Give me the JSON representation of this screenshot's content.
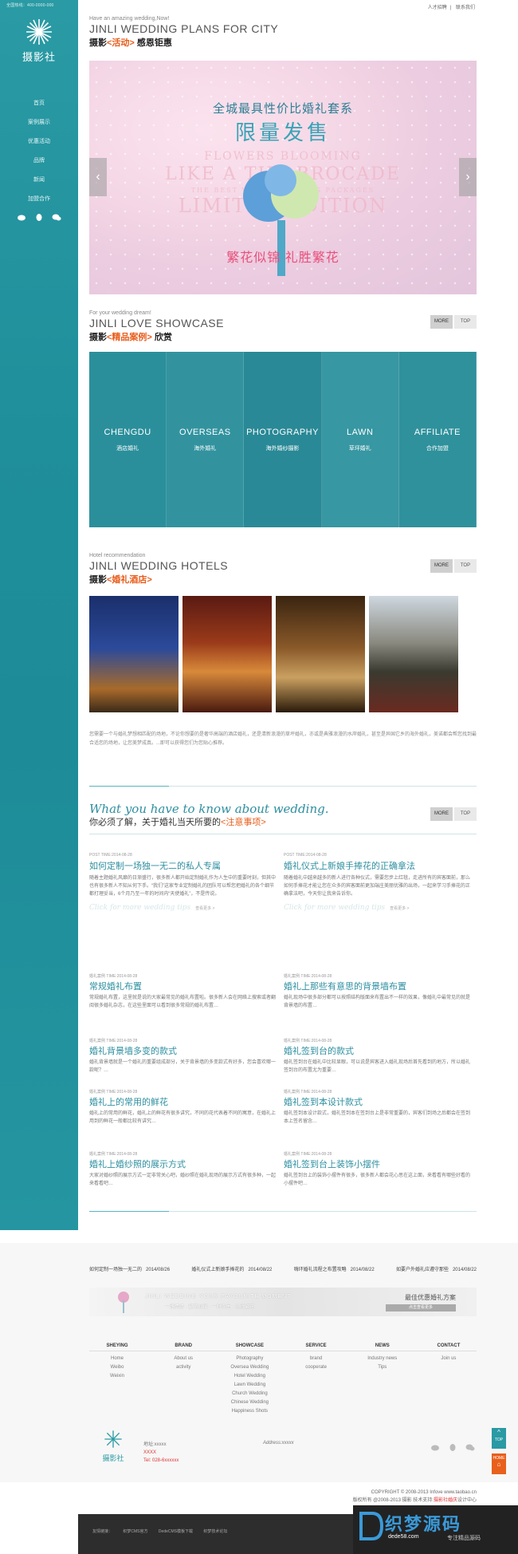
{
  "sidebar": {
    "phone_line": "全国热线：400-0000-000",
    "logo_text": "摄影社",
    "nav": [
      "首页",
      "案例展示",
      "优惠活动",
      "品牌",
      "新闻",
      "加盟合作"
    ]
  },
  "toplinks": {
    "jobs": "人才招聘",
    "contact": "联系我们"
  },
  "plans": {
    "tag": "Have an amazing wedding,Now!",
    "en_title": "JINLI WEDDING PLANS FOR CITY",
    "cn_prefix": "摄影",
    "cn_hl": "<活动>",
    "cn_suffix": "感恩钜惠"
  },
  "banner": {
    "line1": "全城最具性价比婚礼套系",
    "line2": "限量发售",
    "faint1": "FLOWERS BLOOMING",
    "faint2": "LIKE A THE BROCADE",
    "faint3": "THE BEST VALUE WEDDING PACKAGES",
    "faint4": "LIMITED EDITION",
    "bottom": "繁花似锦 礼胜繁花",
    "prev": "‹",
    "next": "›"
  },
  "showcase": {
    "tag": "For your wedding dream!",
    "en_title": "JINLI LOVE SHOWCASE",
    "cn_prefix": "摄影",
    "cn_hl": "<精品案例>",
    "cn_suffix": "欣赏",
    "more": "MORE",
    "top": "TOP",
    "items": [
      {
        "en": "CHENGDU",
        "cn": "酒店婚礼",
        "color": "#2b8f9b"
      },
      {
        "en": "OVERSEAS",
        "cn": "海外婚礼",
        "color": "#32939f"
      },
      {
        "en": "PHOTOGRAPHY",
        "cn": "海外婚纱摄影",
        "color": "#2a8996"
      },
      {
        "en": "LAWN",
        "cn": "草坪婚礼",
        "color": "#3797a2"
      },
      {
        "en": "AFFILIATE",
        "cn": "合作加盟",
        "color": "#2f919c"
      }
    ]
  },
  "hotels": {
    "tag": "Hotel recommendation",
    "en_title": "JINLI WEDDING HOTELS",
    "cn_prefix": "摄影",
    "cn_hl": "<婚礼酒店>",
    "more": "MORE",
    "top": "TOP",
    "desc": "您需要一个与婚礼梦想相匹配的场地，不论你想要的是奢华高端的酒店婚礼，还是清新浪漫的草坪婚礼，亦或是典雅浪漫的水岸婚礼，甚至是异国它乡的海外婚礼，美诺都会帮您找到最合适您的场地，让您美梦成真。...即可以获得您们为您贴心推荐。"
  },
  "knowledge": {
    "script_title": "What you have to know about wedding.",
    "sub_prefix": "你必须了解，关于婚礼当天所要的",
    "sub_hl": "<注意事项>",
    "more": "MORE",
    "top": "TOP",
    "featured": [
      {
        "meta": "POST TIME:2014-08-28",
        "title": "如何定制一场独一无二的私人专属",
        "desc": "随着主题婚礼风靡的日渐盛行，很多新人都开始定制婚礼作为人生中的重要时刻，但其中也有很多新人不知从何下手。“我们”这家专业定制婚礼的团队可以帮您把婚礼的各个细节都打理妥当，6个月乃至一年的时间内“天使婚礼”，不是传说。",
        "cursive": "Click for more wedding tips",
        "more": "查看更多 >"
      },
      {
        "meta": "POST TIME:2014-08-28",
        "title": "婚礼仪式上新娘手捧花的正确拿法",
        "desc": "随着婚礼中越来越多的新人进行各种仪式，需要您步上红毯，走进所有的宾客面前，那么如何手捧花才能让您在众多的宾客面前更加端庄美丽优雅的出场，一起来学习手捧花的正确拿法吧，今天你让我来告诉你。",
        "cursive": "Click for more wedding tips",
        "more": "查看更多 >"
      }
    ],
    "list": [
      {
        "meta": "婚礼案例  TIME:2014-08-28",
        "title": "常规婚礼布置",
        "desc": "常规婚礼布置，这里就是说的大家最常见的婚礼布置啦。很多新人会在网络上搜索或者翻阅很多婚礼杂志，在这些里面可以看到很多常规的婚礼布置…"
      },
      {
        "meta": "婚礼案例  TIME:2014-08-28",
        "title": "婚礼上那些有意思的背景墙布置",
        "desc": "婚礼现场中很多部分都可以按照结构版面来布置出不一样的效果，像婚礼中最常见的就是背景墙的布置…"
      },
      {
        "meta": "婚礼案例  TIME:2014-08-28",
        "title": "婚礼背景墙多变的款式",
        "desc": "婚礼背景墙就是一个婚礼的重要组成部分，关于背景墙的多变款式有好多，您会喜欢哪一款呢？…"
      },
      {
        "meta": "婚礼案例  TIME:2014-08-28",
        "title": "婚礼签到台的款式",
        "desc": "婚礼签到台在婚礼中比较显眼，可以说是宾客进入婚礼现场后首先看到的地方，所以婚礼签到台的布置尤为重要…"
      },
      {
        "meta": "婚礼案例  TIME:2014-08-28",
        "title": "婚礼上的常用的鲜花",
        "desc": "婚礼上的常用的鲜花，婚礼上的鲜花有很多讲究，不同的花代表着不同的寓意，在婚礼上用到的鲜花一般都比较有讲究…"
      },
      {
        "meta": "婚礼案例  TIME:2014-08-28",
        "title": "婚礼签到本设计款式",
        "desc": "婚礼签到本设计款式，婚礼签到本在签到台上是非常重要的，宾客们到场之后都会在签到本上签名留念…"
      },
      {
        "meta": "婚礼案例  TIME:2014-08-28",
        "title": "婚礼上婚纱照的展示方式",
        "desc": "大家对婚纱照的展示方式一定非常关心吧，婚纱照在婚礼现场的展示方式有很多种，一起来看看吧…"
      },
      {
        "meta": "婚礼案例  TIME:2014-08-28",
        "title": "婚礼签到台上装饰小摆件",
        "desc": "婚礼签到台上的装饰小摆件有很多，很多新人都会花心思在这上面，来看看有哪些好看的小摆件吧…"
      }
    ]
  },
  "footer": {
    "news": [
      {
        "title": "如何定制一场独一无二的",
        "date": "2014/08/26"
      },
      {
        "title": "婚礼仪式上新娘手捧花的",
        "date": "2014/08/22"
      },
      {
        "title": "嗨环婚礼流程之布置攻略",
        "date": "2014/08/22"
      },
      {
        "title": "如要户外婚礼应遵守那些",
        "date": "2014/08/22"
      }
    ],
    "ad_line1": "JINLI WEDDING  YOUR FAVOURITE MOMENT",
    "ad_line2": "一路情缘 · 繁花似锦 · 一时许生 · 礼胜繁花",
    "ad_right1": "最佳优惠婚礼方案",
    "ad_right2": "点击查看更多",
    "sitemap_heads": [
      "SHEYING",
      "BRAND",
      "SHOWCASE",
      "SERVICE",
      "NEWS",
      "CONTACT"
    ],
    "sitemap_cols": [
      [
        "Home",
        "Weibo",
        "Weixin"
      ],
      [
        "About us",
        "activity"
      ],
      [
        "Photography",
        "Oversea Wedding",
        "Hotel Wedding",
        "Lawn Wedding",
        "Church Wedding",
        "Chinese Wedding",
        "Happiness Shots"
      ],
      [
        "brand",
        "cooperate"
      ],
      [
        "Industry news",
        "Tips"
      ],
      [
        "Join us"
      ]
    ],
    "logo2_text": "摄影社",
    "addr1": "地址:xxxxx",
    "addr_red": "XXXX",
    "tel": "Tel: 028-6xxxxxx",
    "address_en": "Address:xxxxx",
    "top_icon": "TOP",
    "home_icon": "HOME",
    "copy1": "COPYRIGHT © 2008-2013 Infove www.taobao.cn",
    "copy2_prefix": "版权所有 @2008-2013 摄影  技术支持:",
    "copy2_red": "摄影社婚庆",
    "copy2_suffix": "设计中心",
    "bottom_links": [
      "友情链接：",
      "织梦CMS官方",
      "DedeCMS模板下载",
      "织梦技术论坛"
    ],
    "watermark_big": "织梦源码",
    "watermark_site": "dede58.com",
    "watermark_tag": "专注精品源码"
  }
}
